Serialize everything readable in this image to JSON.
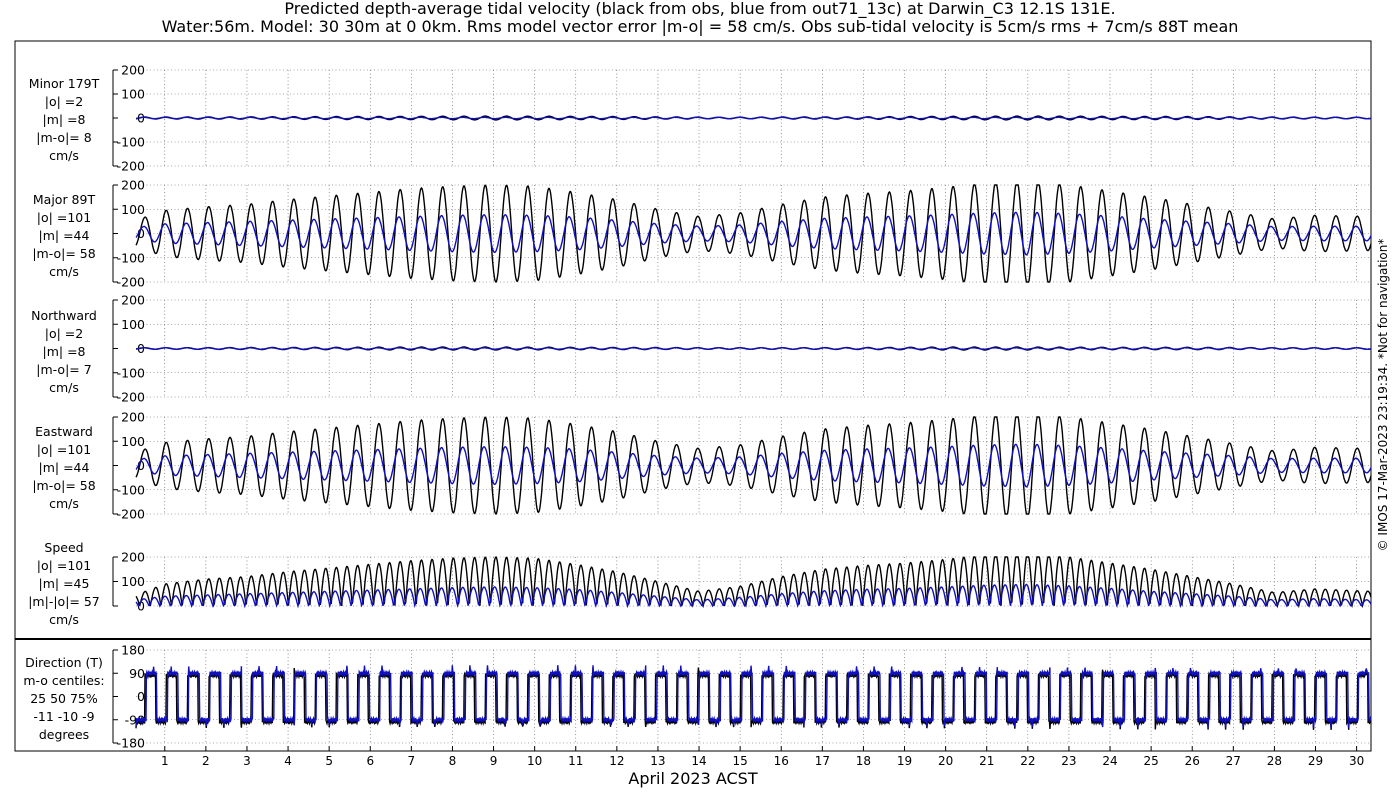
{
  "title_line1": "Predicted depth-average tidal velocity (black from obs, blue from out71_13c) at Darwin_C3 12.1S 131E.",
  "title_line2": "Water:56m. Model: 30 30m at 0 0km. Rms model vector error |m-o| = 58 cm/s. Obs sub-tidal velocity is 5cm/s rms + 7cm/s 88T mean",
  "xlabel": "April 2023 ACST",
  "side_note": "© IMOS 17-Mar-2023 23:19:34. *Not for navigation*",
  "colors": {
    "obs": "#000000",
    "model": "#1010c0"
  },
  "chart_data": {
    "type": "line",
    "x_axis": {
      "range": [
        0.3,
        30.35
      ],
      "ticks": [
        1,
        2,
        3,
        4,
        5,
        6,
        7,
        8,
        9,
        10,
        11,
        12,
        13,
        14,
        15,
        16,
        17,
        18,
        19,
        20,
        21,
        22,
        23,
        24,
        25,
        26,
        27,
        28,
        29,
        30
      ],
      "grid": true
    },
    "envelope_note": "approximate peak amplitude (cm/s) of each series at x (day of April 2023)",
    "panels": [
      {
        "name": "minor",
        "label": [
          "Minor 179T",
          "|o| =2",
          "|m| =8",
          "|m-o|= 8",
          "cm/s"
        ],
        "ylim": [
          -200,
          200
        ],
        "yticks": [
          -200,
          -100,
          0,
          100,
          200
        ],
        "kind": "velocity",
        "series": [
          {
            "name": "obs",
            "envelope": {
              "x": [
                0.3,
                1,
                3,
                5,
                7,
                9,
                11,
                13,
                14.5,
                16,
                18,
                20,
                22,
                24,
                26,
                28,
                30.35
              ],
              "y": [
                4,
                4,
                5,
                6,
                7,
                8,
                7,
                5,
                3,
                4,
                5,
                7,
                8,
                7,
                6,
                4,
                3
              ]
            }
          },
          {
            "name": "model",
            "envelope": {
              "x": [
                0.3,
                30.35
              ],
              "y": [
                3,
                3
              ]
            }
          }
        ]
      },
      {
        "name": "major",
        "label": [
          "Major 89T",
          "|o| =101",
          "|m| =44",
          "|m-o|= 58",
          "cm/s"
        ],
        "ylim": [
          -200,
          200
        ],
        "yticks": [
          -200,
          -100,
          0,
          100,
          200
        ],
        "kind": "velocity",
        "series": [
          {
            "name": "obs",
            "envelope": {
              "x": [
                0.3,
                1,
                2,
                3,
                4,
                5,
                6,
                7,
                8,
                9,
                10,
                11,
                12,
                13,
                14,
                15,
                16,
                17,
                18,
                19,
                20,
                21,
                22,
                23,
                24,
                25,
                26,
                27,
                28,
                29,
                30.35
              ],
              "y": [
                55,
                95,
                110,
                120,
                140,
                155,
                170,
                185,
                195,
                200,
                195,
                170,
                140,
                100,
                70,
                85,
                120,
                150,
                165,
                175,
                190,
                210,
                215,
                200,
                175,
                150,
                120,
                90,
                60,
                75,
                70
              ]
            }
          },
          {
            "name": "model",
            "envelope": {
              "x": [
                0.3,
                1,
                2,
                3,
                4,
                5,
                6,
                7,
                8,
                9,
                10,
                11,
                12,
                13,
                14,
                15,
                16,
                17,
                18,
                19,
                20,
                21,
                22,
                23,
                24,
                25,
                26,
                27,
                28,
                29,
                30.35
              ],
              "y": [
                25,
                40,
                45,
                50,
                55,
                60,
                65,
                70,
                75,
                78,
                75,
                68,
                55,
                40,
                30,
                35,
                50,
                62,
                68,
                72,
                78,
                85,
                88,
                82,
                72,
                60,
                50,
                40,
                28,
                30,
                30
              ]
            }
          }
        ]
      },
      {
        "name": "northward",
        "label": [
          "Northward",
          "|o| =2",
          "|m| =8",
          "|m-o|= 7",
          "cm/s"
        ],
        "ylim": [
          -200,
          200
        ],
        "yticks": [
          -200,
          -100,
          0,
          100,
          200
        ],
        "kind": "velocity",
        "series": [
          {
            "name": "obs",
            "envelope": {
              "x": [
                0.3,
                1,
                3,
                5,
                7,
                9,
                11,
                13,
                14.5,
                16,
                18,
                20,
                22,
                24,
                26,
                28,
                30.35
              ],
              "y": [
                3,
                3,
                4,
                5,
                6,
                6,
                5,
                4,
                3,
                3,
                4,
                6,
                6,
                5,
                5,
                3,
                3
              ]
            }
          },
          {
            "name": "model",
            "envelope": {
              "x": [
                0.3,
                30.35
              ],
              "y": [
                3,
                3
              ]
            }
          }
        ]
      },
      {
        "name": "eastward",
        "label": [
          "Eastward",
          "|o| =101",
          "|m| =44",
          "|m-o|= 58",
          "cm/s"
        ],
        "ylim": [
          -200,
          200
        ],
        "yticks": [
          -200,
          -100,
          0,
          100,
          200
        ],
        "kind": "velocity",
        "series": [
          {
            "name": "obs",
            "envelope": {
              "x": [
                0.3,
                1,
                2,
                3,
                4,
                5,
                6,
                7,
                8,
                9,
                10,
                11,
                12,
                13,
                14,
                15,
                16,
                17,
                18,
                19,
                20,
                21,
                22,
                23,
                24,
                25,
                26,
                27,
                28,
                29,
                30.35
              ],
              "y": [
                55,
                95,
                110,
                120,
                140,
                155,
                170,
                185,
                195,
                200,
                195,
                170,
                140,
                100,
                70,
                85,
                120,
                150,
                165,
                175,
                190,
                210,
                215,
                200,
                175,
                150,
                120,
                90,
                60,
                75,
                70
              ]
            }
          },
          {
            "name": "model",
            "envelope": {
              "x": [
                0.3,
                1,
                2,
                3,
                4,
                5,
                6,
                7,
                8,
                9,
                10,
                11,
                12,
                13,
                14,
                15,
                16,
                17,
                18,
                19,
                20,
                21,
                22,
                23,
                24,
                25,
                26,
                27,
                28,
                29,
                30.35
              ],
              "y": [
                25,
                40,
                45,
                50,
                55,
                60,
                65,
                70,
                75,
                78,
                75,
                68,
                55,
                40,
                30,
                35,
                50,
                62,
                68,
                72,
                78,
                85,
                88,
                82,
                72,
                60,
                50,
                40,
                28,
                30,
                30
              ]
            }
          }
        ]
      },
      {
        "name": "speed",
        "label": [
          "Speed",
          "|o| =101",
          "|m| =45",
          "|m|-|o|= 57",
          "cm/s"
        ],
        "ylim": [
          0,
          200
        ],
        "yticks": [
          0,
          100,
          200
        ],
        "kind": "speed",
        "series": [
          {
            "name": "obs",
            "envelope": {
              "x": [
                0.3,
                1,
                2,
                3,
                4,
                5,
                6,
                7,
                8,
                9,
                10,
                11,
                12,
                13,
                14,
                15,
                16,
                17,
                18,
                19,
                20,
                21,
                22,
                23,
                24,
                25,
                26,
                27,
                28,
                29,
                30.35
              ],
              "y": [
                45,
                90,
                110,
                120,
                140,
                155,
                170,
                185,
                195,
                200,
                195,
                170,
                140,
                100,
                60,
                80,
                120,
                150,
                165,
                175,
                190,
                210,
                215,
                200,
                175,
                150,
                120,
                90,
                55,
                70,
                60
              ]
            }
          },
          {
            "name": "model",
            "envelope": {
              "x": [
                0.3,
                1,
                2,
                3,
                4,
                5,
                6,
                7,
                8,
                9,
                10,
                11,
                12,
                13,
                14,
                15,
                16,
                17,
                18,
                19,
                20,
                21,
                22,
                23,
                24,
                25,
                26,
                27,
                28,
                29,
                30.35
              ],
              "y": [
                25,
                40,
                45,
                50,
                55,
                60,
                65,
                70,
                75,
                78,
                75,
                68,
                55,
                40,
                25,
                35,
                50,
                62,
                68,
                72,
                78,
                85,
                88,
                82,
                72,
                60,
                50,
                40,
                25,
                30,
                25
              ]
            }
          }
        ]
      },
      {
        "name": "direction",
        "label": [
          "Direction (T)",
          "m-o centiles:",
          "25  50  75%",
          "-11 -10  -9",
          "degrees"
        ],
        "ylim": [
          -180,
          180
        ],
        "yticks": [
          -180,
          -90,
          0,
          90,
          180
        ],
        "kind": "direction",
        "series": [
          {
            "name": "obs",
            "levels": [
              90,
              -90
            ]
          },
          {
            "name": "model",
            "levels": [
              90,
              -90
            ]
          }
        ]
      }
    ]
  }
}
